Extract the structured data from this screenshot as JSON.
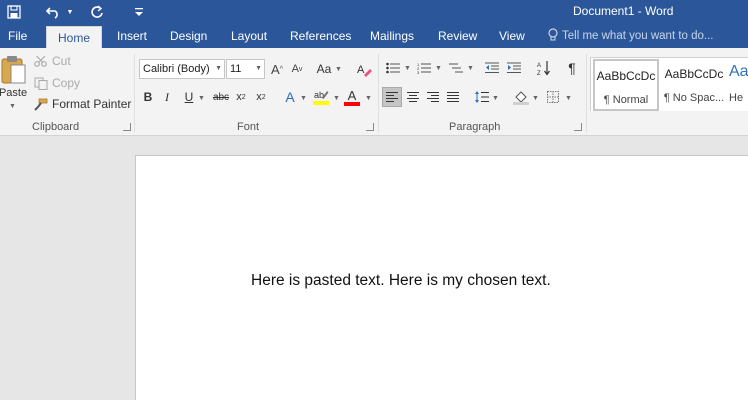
{
  "title_bar": {
    "document_title": "Document1 - Word",
    "save_icon": "save-icon",
    "undo_icon": "undo-icon",
    "redo_icon": "redo-icon",
    "customize_icon": "customize-qat-icon"
  },
  "tabs": {
    "file": "File",
    "home": "Home",
    "insert": "Insert",
    "design": "Design",
    "layout": "Layout",
    "references": "References",
    "mailings": "Mailings",
    "review": "Review",
    "view": "View",
    "active": "Home"
  },
  "tell_me": {
    "placeholder": "Tell me what you want to do..."
  },
  "clipboard": {
    "paste": "Paste",
    "cut": "Cut",
    "copy": "Copy",
    "format_painter": "Format Painter",
    "group_label": "Clipboard"
  },
  "font": {
    "font_name": "Calibri (Body)",
    "font_size": "11",
    "change_case": "Aa",
    "bold": "B",
    "italic": "I",
    "underline": "U",
    "strikethrough": "abc",
    "subscript": "x",
    "superscript": "x",
    "text_effects": "A",
    "font_color": "A",
    "group_label": "Font",
    "highlight_color": "#ffff00",
    "font_color_value": "#ff0000"
  },
  "paragraph": {
    "group_label": "Paragraph",
    "show_marks": "¶"
  },
  "styles": {
    "items": [
      {
        "sample": "AaBbCcDc",
        "name": "¶ Normal"
      },
      {
        "sample": "AaBbCcDc",
        "name": "¶ No Spac..."
      },
      {
        "sample": "Aa",
        "name": "He"
      }
    ]
  },
  "document": {
    "text": "Here is pasted text. Here is my chosen text."
  },
  "colors": {
    "accent": "#2b579a",
    "ribbon_bg": "#f3f3f3",
    "workspace_bg": "#e6e6e6"
  }
}
